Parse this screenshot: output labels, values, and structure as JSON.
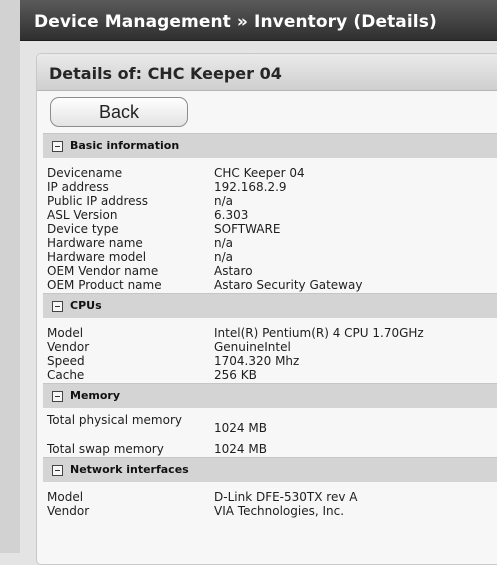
{
  "window": {
    "title": "Device Management » Inventory (Details)"
  },
  "details": {
    "title": "Details of: CHC Keeper 04",
    "back_label": "Back",
    "sections": [
      {
        "title": "Basic information",
        "rows": [
          {
            "label": "Devicename",
            "value": "CHC Keeper 04"
          },
          {
            "label": "IP address",
            "value": "192.168.2.9"
          },
          {
            "label": "Public IP address",
            "value": "n/a"
          },
          {
            "label": "ASL Version",
            "value": "6.303"
          },
          {
            "label": "Device type",
            "value": "SOFTWARE"
          },
          {
            "label": "Hardware name",
            "value": "n/a"
          },
          {
            "label": "Hardware model",
            "value": "n/a"
          },
          {
            "label": "OEM Vendor name",
            "value": "Astaro"
          },
          {
            "label": "OEM Product name",
            "value": "Astaro Security Gateway"
          }
        ]
      },
      {
        "title": "CPUs",
        "rows": [
          {
            "label": "Model",
            "value": "Intel(R) Pentium(R) 4 CPU 1.70GHz"
          },
          {
            "label": "Vendor",
            "value": "GenuineIntel"
          },
          {
            "label": "Speed",
            "value": "1704.320 Mhz"
          },
          {
            "label": "Cache",
            "value": "256 KB"
          }
        ]
      },
      {
        "title": "Memory",
        "rows": [
          {
            "label": "Total physical memory",
            "value": "1024 MB"
          },
          {
            "label": "Total swap memory",
            "value": "1024 MB"
          }
        ]
      },
      {
        "title": "Network interfaces",
        "rows": [
          {
            "label": "Model",
            "value": "D-Link DFE-530TX rev A"
          },
          {
            "label": "Vendor",
            "value": "VIA Technologies, Inc."
          }
        ]
      }
    ]
  }
}
